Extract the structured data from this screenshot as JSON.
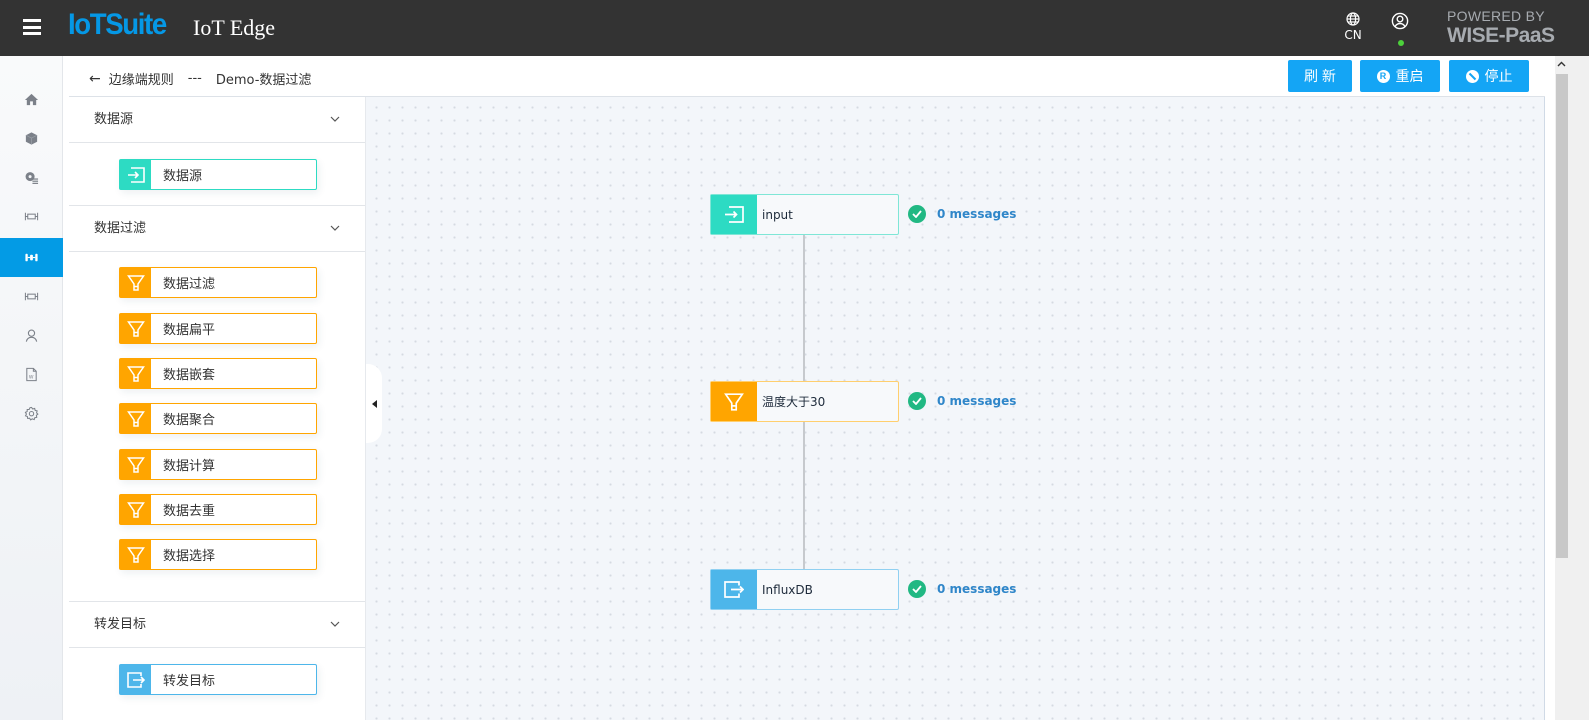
{
  "topbar": {
    "brand": "IoTSuite",
    "product": "IoT Edge",
    "language": "CN",
    "powered_by_line1": "POWERED BY",
    "powered_by_line2": "WISE-PaaS",
    "user_status_color": "#4cd13b"
  },
  "leftnav": {
    "items": [
      {
        "icon": "home-icon",
        "active": false
      },
      {
        "icon": "cube-icon",
        "active": false
      },
      {
        "icon": "gear-list-icon",
        "active": false
      },
      {
        "icon": "device-bracket-icon",
        "active": false
      },
      {
        "icon": "rule-flow-icon",
        "active": true
      },
      {
        "icon": "device-bracket-icon",
        "active": false
      },
      {
        "icon": "user-icon",
        "active": false
      },
      {
        "icon": "word-document-icon",
        "active": false
      },
      {
        "icon": "settings-icon",
        "active": false
      }
    ]
  },
  "breadcrumb": {
    "parent": "边缘端规则",
    "separator": "---",
    "current": "Demo-数据过滤"
  },
  "toolbar": {
    "refresh_label": "刷 新",
    "restart_label": "重启",
    "restart_icon_char": "R",
    "stop_label": "停止",
    "accent_color": "#14a5f5"
  },
  "palette": {
    "groups": [
      {
        "title": "数据源",
        "type": "source",
        "items": [
          "数据源"
        ]
      },
      {
        "title": "数据过滤",
        "type": "filter",
        "items": [
          "数据过滤",
          "数据扁平",
          "数据嵌套",
          "数据聚合",
          "数据计算",
          "数据去重",
          "数据选择"
        ]
      },
      {
        "title": "转发目标",
        "type": "sink",
        "items": [
          "转发目标"
        ]
      }
    ],
    "colors": {
      "source": "#2ddbc3",
      "filter": "#ffa500",
      "sink": "#4db6ea"
    }
  },
  "flow": {
    "nodes": [
      {
        "label": "input",
        "type": "source",
        "status": "0 messages"
      },
      {
        "label": "温度大于30",
        "type": "filter",
        "status": "0 messages"
      },
      {
        "label": "InfluxDB",
        "type": "sink",
        "status": "0 messages"
      }
    ],
    "status_ok_color": "#21b883"
  }
}
